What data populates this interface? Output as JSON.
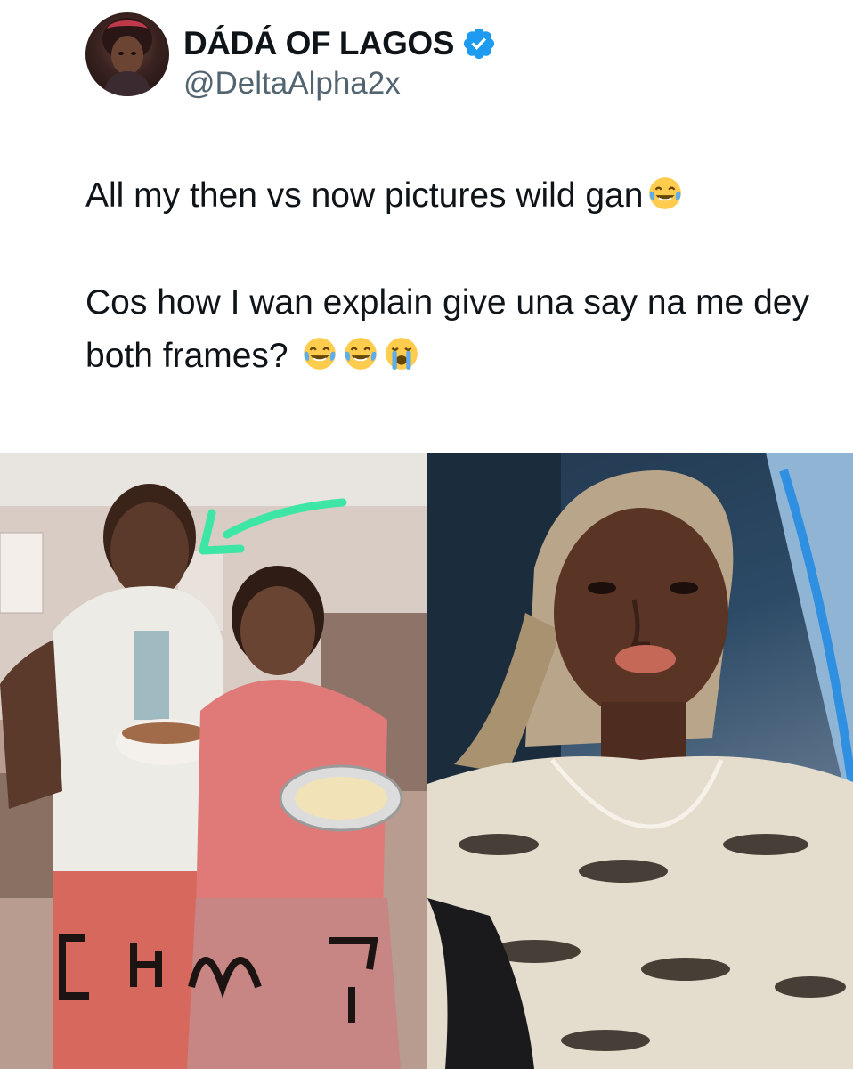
{
  "tweet": {
    "display_name": "DÁDÁ OF LAGOS",
    "handle": "@DeltaAlpha2x",
    "verified_icon": "verified-badge-icon",
    "verified_color": "#1d9bf0",
    "paragraphs": [
      "All my then vs now pictures wild gan",
      "Cos how I wan explain give una say na me dey both frames?"
    ],
    "paragraph_emojis": [
      [
        "face-with-tears-of-joy-icon"
      ],
      [
        "face-with-tears-of-joy-icon",
        "face-with-tears-of-joy-icon",
        "loudly-crying-face-icon"
      ]
    ]
  },
  "media": {
    "left_image": "then-photo",
    "right_image": "now-photo",
    "left_overlay_text": "CAMP"
  },
  "colors": {
    "text": "#0f1419",
    "secondary": "#536471",
    "arrow": "#3ee6a6"
  }
}
